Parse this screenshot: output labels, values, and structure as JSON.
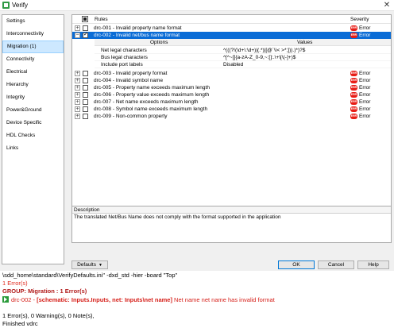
{
  "window": {
    "title": "Verify",
    "close_glyph": "✕"
  },
  "nav": {
    "items": [
      {
        "label": "Settings"
      },
      {
        "label": "Interconnectivity"
      },
      {
        "label": "Migration (1)"
      },
      {
        "label": "Connectivity"
      },
      {
        "label": "Electrical"
      },
      {
        "label": "Hierarchy"
      },
      {
        "label": "Integrity"
      },
      {
        "label": "Power&Ground"
      },
      {
        "label": "Device Specific"
      },
      {
        "label": "HDL Checks"
      },
      {
        "label": "Links"
      }
    ],
    "selected": "Migration (1)"
  },
  "rules": {
    "header": {
      "rules": "Rules",
      "severity": "Severity"
    },
    "items": [
      {
        "name": "drc-001 - Invalid property name format",
        "severity": "Error",
        "checked": false,
        "expander": "+"
      },
      {
        "name": "drc-002 - Invalid net/bus name format",
        "severity": "Error",
        "checked": true,
        "expander": "−"
      },
      {
        "name": "drc-003 - Invalid property format",
        "severity": "Error",
        "checked": false,
        "expander": "+"
      },
      {
        "name": "drc-004 - Invalid symbol name",
        "severity": "Error",
        "checked": false,
        "expander": "+"
      },
      {
        "name": "drc-005 - Property name exceeds maximum length",
        "severity": "Error",
        "checked": false,
        "expander": "+"
      },
      {
        "name": "drc-006 - Property value exceeds maximum length",
        "severity": "Error",
        "checked": false,
        "expander": "+"
      },
      {
        "name": "drc-007 - Net name exceeds maximum length",
        "severity": "Error",
        "checked": false,
        "expander": "+"
      },
      {
        "name": "drc-008 - Symbol name exceeds maximum length",
        "severity": "Error",
        "checked": false,
        "expander": "+"
      },
      {
        "name": "drc-009 - Non-common property",
        "severity": "Error",
        "checked": false,
        "expander": "+"
      }
    ],
    "severity_badge": "ERR"
  },
  "options": {
    "header": {
      "options": "Options",
      "values": "Values"
    },
    "rows": [
      {
        "name": "Net legal characters",
        "value": "^(((?!(\\d+\\:\\d+)|(.*)|[@`\\\\< >*;])).)*)?$"
      },
      {
        "name": "Bus legal characters",
        "value": "^[^~[]{a-zA-Z_0-9,~:[]:.\\+\\[\\(-]+)$"
      },
      {
        "name": "Include port labels",
        "value": "Disabled"
      }
    ]
  },
  "description": {
    "label": "Description",
    "text": "The translated Net/Bus Name does not comply with the format supported in the application"
  },
  "buttons": {
    "defaults": "Defaults",
    "ok": "OK",
    "cancel": "Cancel",
    "help": "Help"
  },
  "console": {
    "cmd": "\\sdd_home\\standard\\VerifyDefaults.ini\" -dxd_std -hier -board \"Top\"",
    "errors_count": "1 Error(s)",
    "group": "GROUP: Migration : 1 Error(s)",
    "entry_prefix": "drc-002 - ",
    "entry_bold": "[schematic: Inputs.Inputs, net: Inputs\\net name]",
    "entry_msg": " Net name net name has invalid format",
    "summary": "1 Error(s), 0 Warning(s), 0 Note(s),",
    "finished": "Finished vdrc"
  },
  "colors": {
    "selection": "#0a6cd6",
    "nav_selection": "#cde8ff",
    "error_red": "#e81d16",
    "console_red": "#d6201a"
  }
}
